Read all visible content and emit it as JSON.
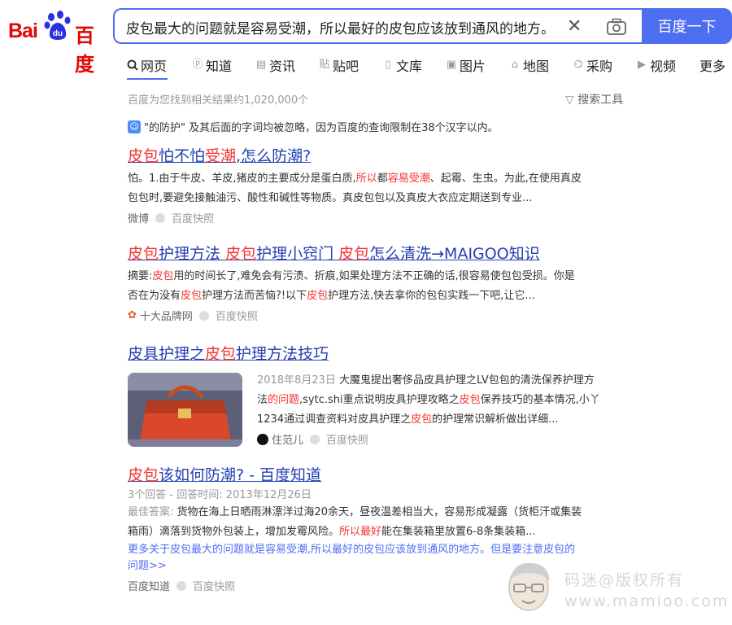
{
  "header": {
    "logo_left": "Bai",
    "logo_right": "百度",
    "search_query": "皮包最大的问题就是容易受潮，所以最好的皮包应该放到通风的地方。",
    "search_button": "百度一下"
  },
  "tabs": [
    {
      "label": "网页",
      "icon": "search-icon"
    },
    {
      "label": "知道",
      "icon": "question-icon"
    },
    {
      "label": "资讯",
      "icon": "news-icon"
    },
    {
      "label": "贴吧",
      "icon": "tieba-icon"
    },
    {
      "label": "文库",
      "icon": "doc-icon"
    },
    {
      "label": "图片",
      "icon": "image-icon"
    },
    {
      "label": "地图",
      "icon": "map-icon"
    },
    {
      "label": "采购",
      "icon": "cart-icon"
    },
    {
      "label": "视频",
      "icon": "video-icon"
    },
    {
      "label": "更多",
      "icon": ""
    }
  ],
  "stats": "百度为您找到相关结果约1,020,000个",
  "search_tools": "搜索工具",
  "notice": "\"的防护\" 及其后面的字词均被忽略，因为百度的查询限制在38个汉字以内。",
  "results": {
    "r1": {
      "title_parts": [
        "皮包",
        "怕不怕",
        "受潮",
        ",怎么防潮?"
      ],
      "abs_l1": [
        "怕。1.由于牛皮、羊皮,猪皮的主要成分是蛋白质,",
        "所以",
        "都",
        "容易受潮",
        "、起霉、生虫。为此,在使用真皮"
      ],
      "abs_l2": "包包时,要避免接触油污、酸性和碱性等物质。真皮包包以及真皮大衣应定期送到专业...",
      "source": "微博",
      "snapshot": "百度快照"
    },
    "r2": {
      "title_parts": [
        "皮包",
        "护理方法 ",
        "皮包",
        "护理小窍门 ",
        "皮包",
        "怎么清洗→MAIGOO知识"
      ],
      "abs_l1": [
        "摘要:",
        "皮包",
        "用的时间长了,难免会有污渍、折痕,如果处理方法不正确的话,很容易使包包受损。你是"
      ],
      "abs_l2": [
        "否在为没有",
        "皮包",
        "护理方法而苦恼?!以下",
        "皮包",
        "护理方法,快去拿你的包包实践一下吧,让它..."
      ],
      "source": "十大品牌网",
      "snapshot": "百度快照"
    },
    "r3": {
      "title_parts": [
        "皮具护理之",
        "皮包",
        "护理方法技巧"
      ],
      "date": "2018年8月23日",
      "abs_l1": " 大魔鬼提出奢侈品皮具护理之LV包包的清洗保养护理方",
      "abs_l2": [
        "法",
        "的问题",
        ",sytc.shi重点说明皮具护理攻略之",
        "皮包",
        "保养技巧的基本情况,小丫"
      ],
      "abs_l3": [
        "1234通过调查资料对皮具护理之",
        "皮包",
        "的护理常识解析做出详细..."
      ],
      "source": "住范儿",
      "snapshot": "百度快照"
    },
    "r4": {
      "title_parts": [
        "皮包",
        "该如何防潮? - 百度知道"
      ],
      "meta": "3个回答 - 回答时间: 2013年12月26日",
      "abs_l1_label": "最佳答案:",
      "abs_l1": " 货物在海上日晒雨淋漂洋过海20余天，昼夜温差相当大，容易形成凝露（货柜汗或集装",
      "abs_l2": [
        "箱雨）滴落到货物外包装上，增加发霉风险。",
        "所以最好",
        "能在集装箱里放置6-8条集装箱..."
      ],
      "more_l1": "更多关于皮包最大的问题就是容易受潮,所以最好的皮包应该放到通风的地方。但是要注意皮包的",
      "more_l2": "问题>>",
      "source": "百度知道",
      "snapshot": "百度快照"
    }
  },
  "watermark": {
    "line1": "码迷@版权所有",
    "line2": "www.mamioo.com"
  },
  "colors": {
    "accent": "#4e6ef2",
    "link": "#2440b3",
    "highlight": "#f73131",
    "brand_red": "#e10601"
  }
}
